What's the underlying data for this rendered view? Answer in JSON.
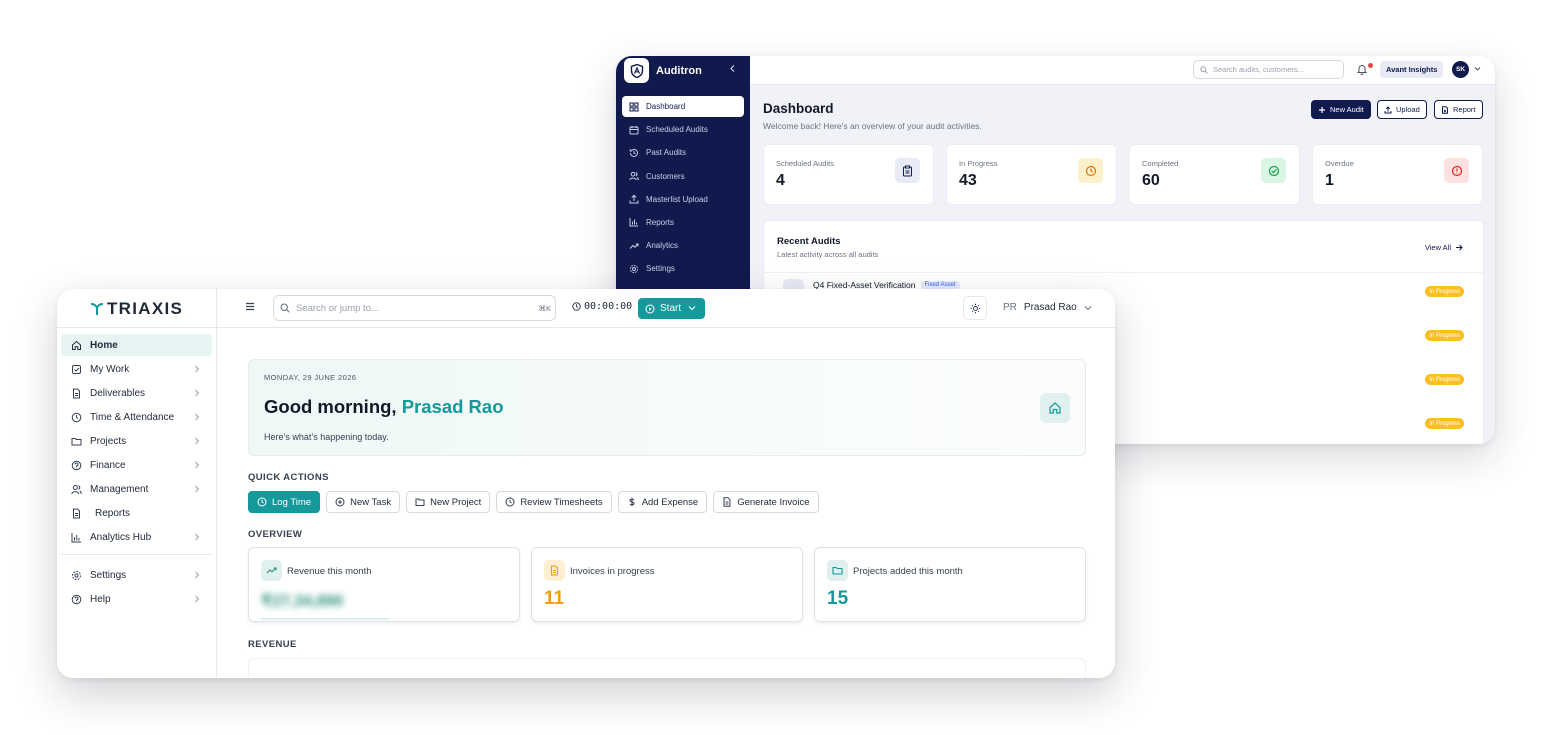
{
  "auditron": {
    "brand": "Auditron",
    "nav": [
      {
        "label": "Dashboard",
        "icon": "dashboard-grid-icon",
        "active": true
      },
      {
        "label": "Scheduled Audits",
        "icon": "calendar-icon"
      },
      {
        "label": "Past Audits",
        "icon": "history-icon"
      },
      {
        "label": "Customers",
        "icon": "users-icon"
      },
      {
        "label": "Masterlist Upload",
        "icon": "upload-icon"
      },
      {
        "label": "Reports",
        "icon": "bar-chart-icon"
      },
      {
        "label": "Analytics",
        "icon": "trend-icon"
      },
      {
        "label": "Settings",
        "icon": "gear-icon"
      }
    ],
    "search_placeholder": "Search audits, customers...",
    "org": "Avant Insights",
    "avatar": "SK",
    "title": "Dashboard",
    "subtitle": "Welcome back! Here's an overview of your audit activities.",
    "actions": {
      "new_audit": "New Audit",
      "upload": "Upload",
      "report": "Report"
    },
    "stats": [
      {
        "label": "Scheduled Audits",
        "value": "4",
        "color": "#111a4d",
        "bg": "#e8eaf6"
      },
      {
        "label": "In Progress",
        "value": "43",
        "color": "#d97706",
        "bg": "#fdf1cc"
      },
      {
        "label": "Completed",
        "value": "60",
        "color": "#16a34a",
        "bg": "#d9f5e3"
      },
      {
        "label": "Overdue",
        "value": "1",
        "color": "#dc2626",
        "bg": "#fde0e0"
      }
    ],
    "recent": {
      "title": "Recent Audits",
      "subtitle": "Latest activity across all audits",
      "view_all": "View All",
      "first_row": {
        "title": "Q4 Fixed-Asset Verification",
        "tag": "Fixed Asset"
      },
      "statuses": [
        "In Progress",
        "In Progress",
        "In Progress",
        "In Progress"
      ]
    }
  },
  "triaxis": {
    "brand": "TRIAXIS",
    "nav": [
      {
        "label": "Home",
        "icon": "home-icon",
        "active": true,
        "chevron": false
      },
      {
        "label": "My Work",
        "icon": "checkbox-icon",
        "chevron": true
      },
      {
        "label": "Deliverables",
        "icon": "file-icon",
        "chevron": true
      },
      {
        "label": "Time & Attendance",
        "icon": "clock-icon",
        "chevron": true
      },
      {
        "label": "Projects",
        "icon": "folder-icon",
        "chevron": true
      },
      {
        "label": "Finance",
        "icon": "finance-icon",
        "chevron": true
      },
      {
        "label": "Management",
        "icon": "users-icon",
        "chevron": true
      },
      {
        "label": "Reports",
        "icon": "document-icon",
        "chevron": false
      },
      {
        "label": "Analytics Hub",
        "icon": "bar-chart-icon",
        "chevron": true
      }
    ],
    "nav_bottom": [
      {
        "label": "Settings",
        "icon": "gear-icon"
      },
      {
        "label": "Help",
        "icon": "help-icon"
      }
    ],
    "search_placeholder": "Search or jump to...",
    "shortcut": "⌘K",
    "timer": "00:00:00",
    "start_label": "Start",
    "user_initials": "PR",
    "user_name": "Prasad Rao",
    "date": "MONDAY, 29 JUNE 2026",
    "greeting": "Good morning,",
    "greeting_name": "Prasad Rao",
    "greeting_sub": "Here’s what’s happening today.",
    "quick_actions_title": "QUICK ACTIONS",
    "quick_actions": [
      {
        "label": "Log Time",
        "icon": "clock-icon"
      },
      {
        "label": "New Task",
        "icon": "plus-circle-icon"
      },
      {
        "label": "New Project",
        "icon": "folder-icon"
      },
      {
        "label": "Review Timesheets",
        "icon": "clock-icon"
      },
      {
        "label": "Add Expense",
        "icon": "dollar-icon"
      },
      {
        "label": "Generate Invoice",
        "icon": "document-icon"
      }
    ],
    "overview_title": "OVERVIEW",
    "cards": [
      {
        "label": "Revenue this month",
        "value": "₹27,34,890",
        "icon": "trend-up-icon",
        "color": "#2a8f78",
        "bg": "#dff0ee"
      },
      {
        "label": "Invoices in progress",
        "value": "11",
        "icon": "invoice-icon",
        "color": "#f59e0b",
        "bg": "#fdefd2"
      },
      {
        "label": "Projects added this month",
        "value": "15",
        "icon": "folder-icon",
        "color": "#15999a",
        "bg": "#dff0ee"
      }
    ],
    "revenue_title": "REVENUE"
  },
  "colors": {
    "auditron_navy": "#111a4d",
    "triaxis_teal": "#15999a"
  }
}
